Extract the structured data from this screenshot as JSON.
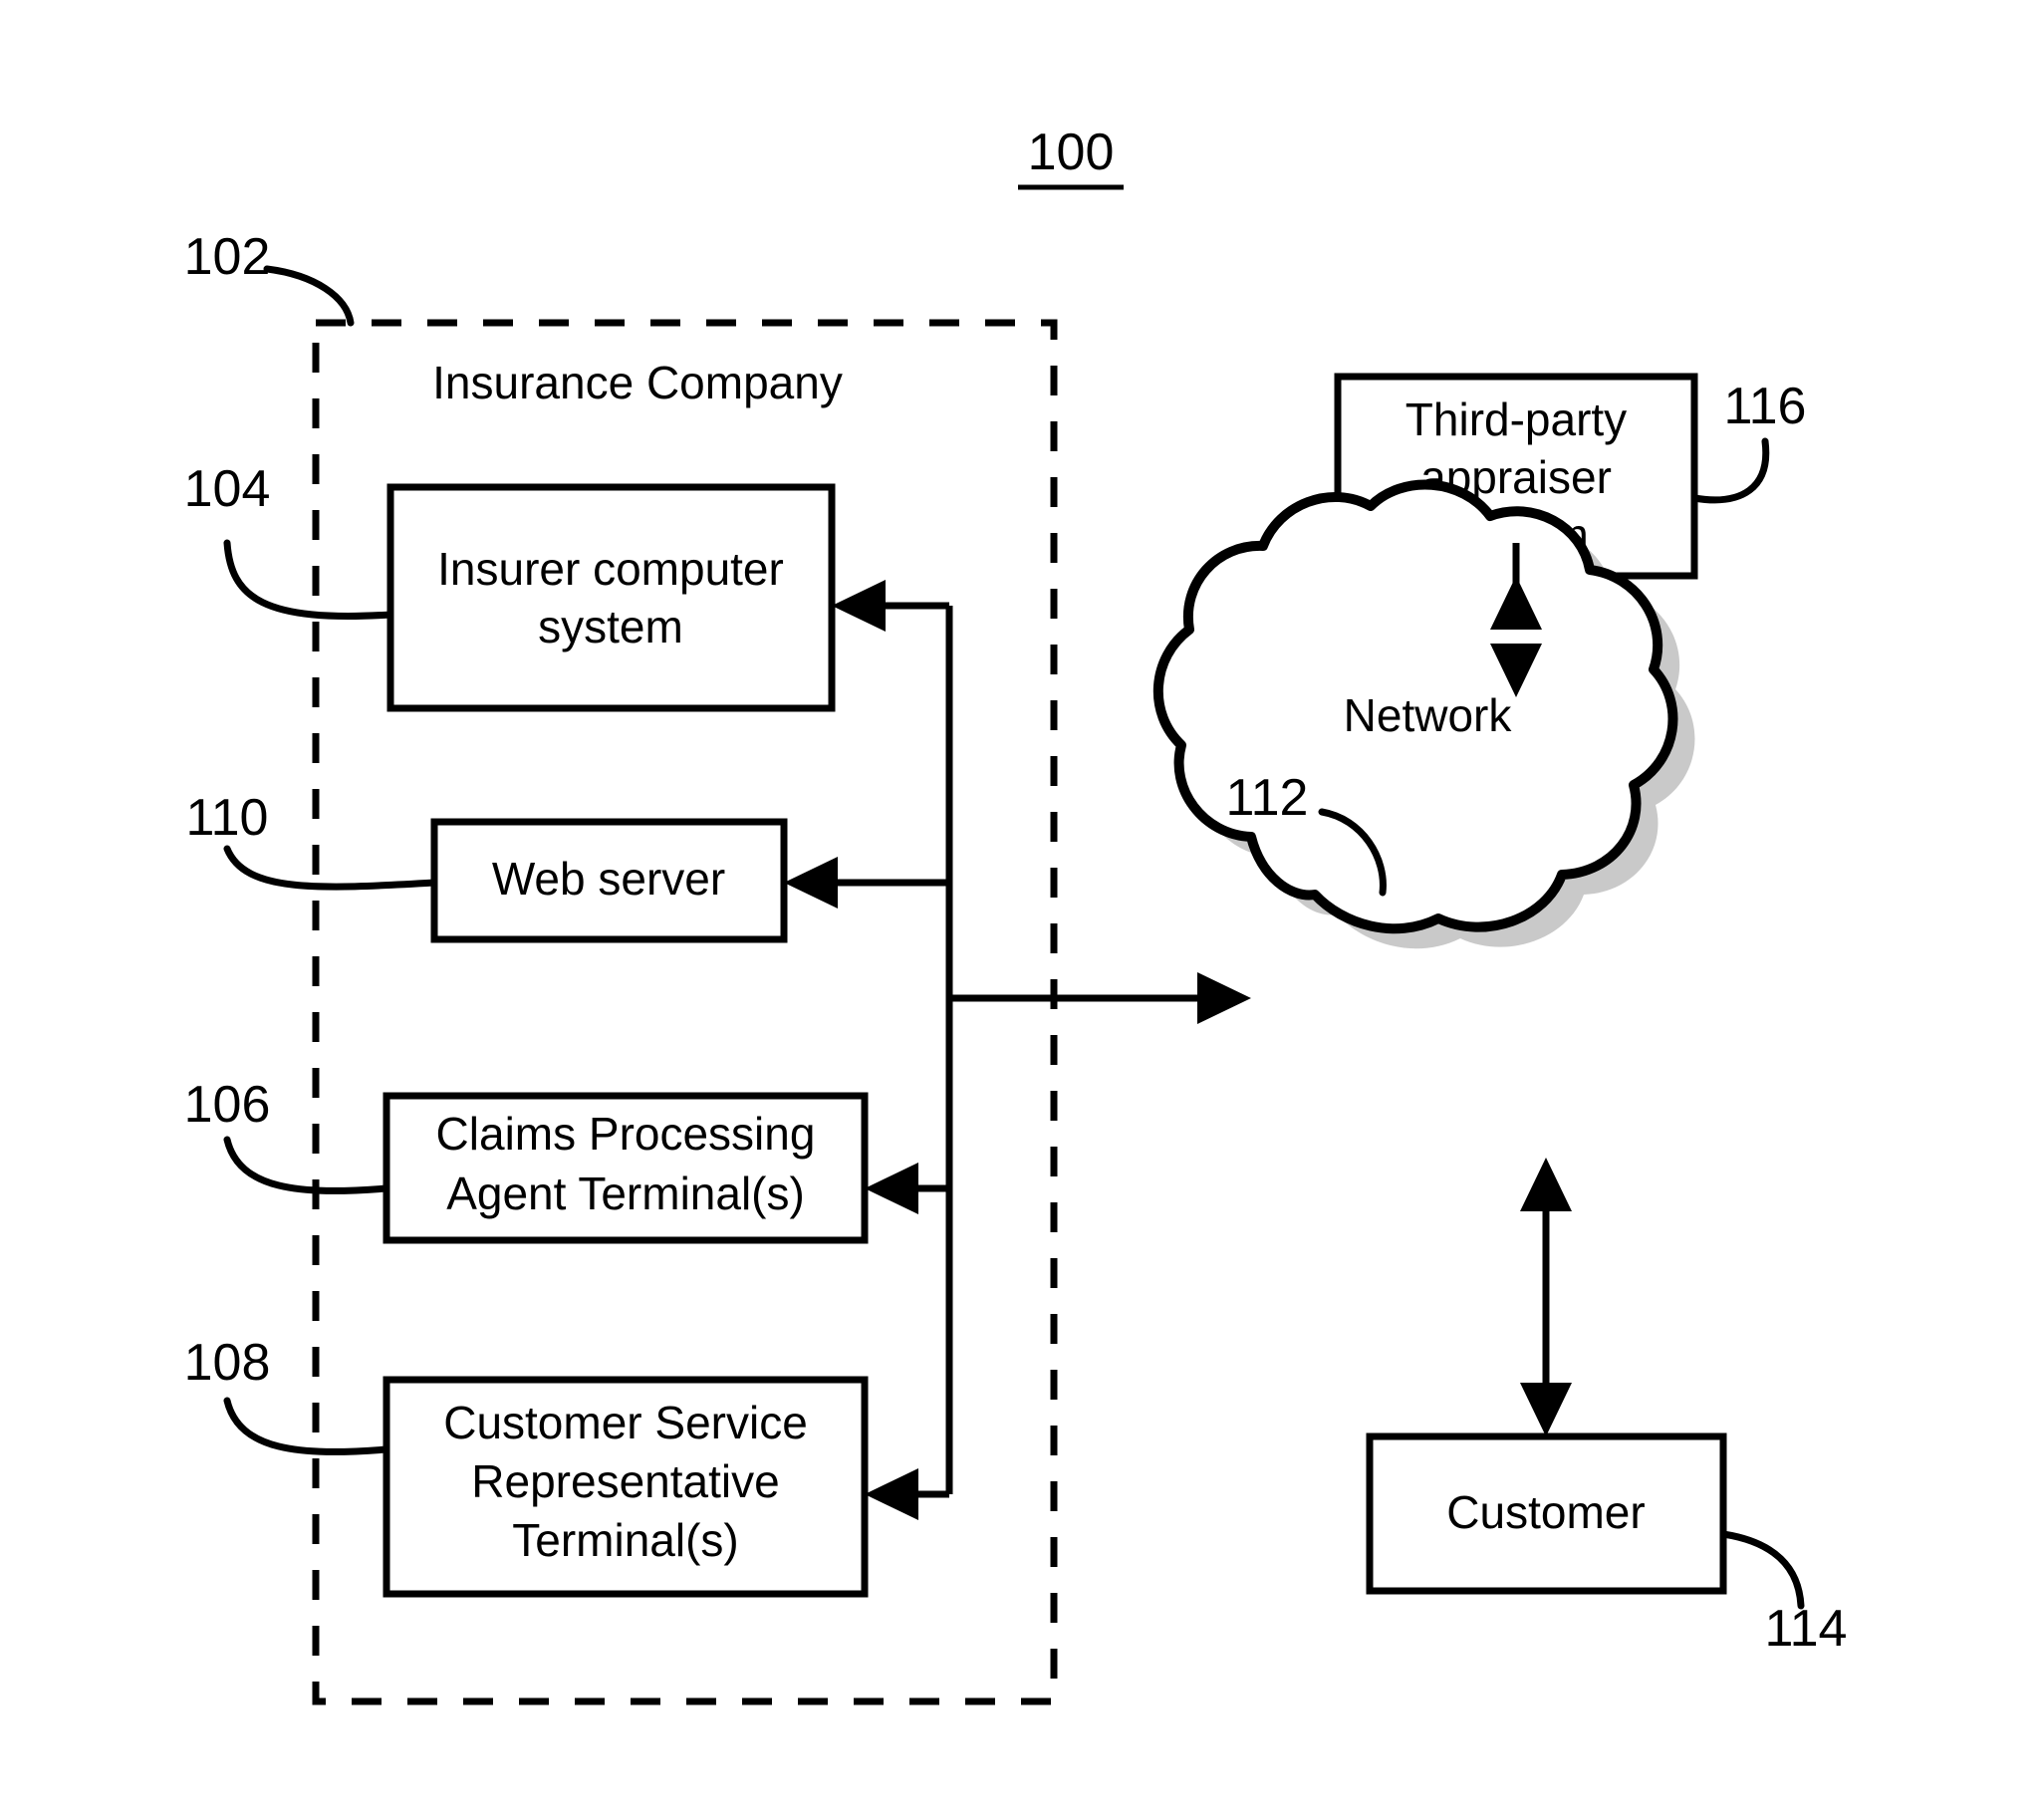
{
  "figure": {
    "title": "100",
    "title_underlined": true
  },
  "boundary": {
    "label": "Insurance Company",
    "ref": "102",
    "style": "dashed"
  },
  "nodes": [
    {
      "id": "insurer-computer-system",
      "ref": "104",
      "lines": [
        "Insurer computer",
        "system"
      ]
    },
    {
      "id": "web-server",
      "ref": "110",
      "lines": [
        "Web server"
      ]
    },
    {
      "id": "claims-processing-agent-terminal",
      "ref": "106",
      "lines": [
        "Claims Processing",
        "Agent Terminal(s)"
      ]
    },
    {
      "id": "customer-service-representative-terminal",
      "ref": "108",
      "lines": [
        "Customer Service",
        "Representative",
        "Terminal(s)"
      ]
    },
    {
      "id": "third-party-appraiser-system",
      "ref": "116",
      "lines": [
        "Third-party",
        "appraiser",
        "system"
      ]
    },
    {
      "id": "network-cloud",
      "ref": "112",
      "lines": [
        "Network"
      ]
    },
    {
      "id": "customer",
      "ref": "114",
      "lines": [
        "Customer"
      ]
    }
  ],
  "connections": [
    {
      "from": "network-cloud",
      "to": "insurer-computer-system",
      "arrow": "single"
    },
    {
      "from": "network-cloud",
      "to": "web-server",
      "arrow": "single"
    },
    {
      "from": "network-cloud",
      "to": "claims-processing-agent-terminal",
      "arrow": "single"
    },
    {
      "from": "network-cloud",
      "to": "customer-service-representative-terminal",
      "arrow": "single"
    },
    {
      "from": "insurance-company-bus",
      "to": "network-cloud",
      "arrow": "single"
    },
    {
      "from": "network-cloud",
      "to": "third-party-appraiser-system",
      "arrow": "double"
    },
    {
      "from": "network-cloud",
      "to": "customer",
      "arrow": "double"
    }
  ],
  "colors": {
    "stroke": "#000000",
    "background": "#ffffff",
    "cloud_shadow": "#c9c9c9"
  }
}
